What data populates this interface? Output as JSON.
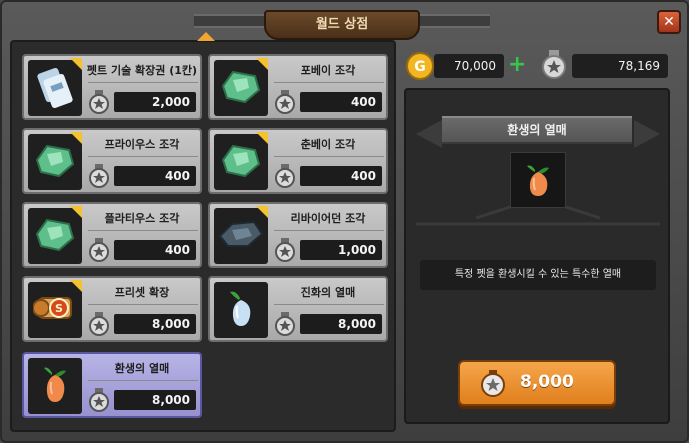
{
  "title": "월드 상점",
  "currency": {
    "gold": "70,000",
    "medal": "78,169"
  },
  "colors": {
    "accent_orange": "#f0a630",
    "selected_item": "#9791cf",
    "panel_dark": "#2b2b2b"
  },
  "items": [
    {
      "name": "펫트 기술 확장권 (1칸)",
      "price": "2,000",
      "icon": "ticket-icon",
      "locked": true
    },
    {
      "name": "포베이 조각",
      "price": "400",
      "icon": "green-shard-icon",
      "locked": true
    },
    {
      "name": "프라이우스 조각",
      "price": "400",
      "icon": "green-shard-icon",
      "locked": true
    },
    {
      "name": "춘베이 조각",
      "price": "400",
      "icon": "green-shard-icon",
      "locked": true
    },
    {
      "name": "플라티우스 조각",
      "price": "400",
      "icon": "green-shard-icon",
      "locked": true
    },
    {
      "name": "리바이어던 조각",
      "price": "1,000",
      "icon": "dark-shard-icon",
      "locked": true
    },
    {
      "name": "프리셋 확장",
      "price": "8,000",
      "icon": "scroll-icon",
      "locked": true
    },
    {
      "name": "진화의 열매",
      "price": "8,000",
      "icon": "blue-fruit-icon",
      "locked": false
    },
    {
      "name": "환생의 열매",
      "price": "8,000",
      "icon": "orange-fruit-icon",
      "locked": false,
      "selected": true
    }
  ],
  "detail": {
    "name": "환생의 열매",
    "description": "특정 펫을 환생시킬 수 있는 특수한 열매",
    "price": "8,000"
  },
  "close_icon": "close-icon"
}
